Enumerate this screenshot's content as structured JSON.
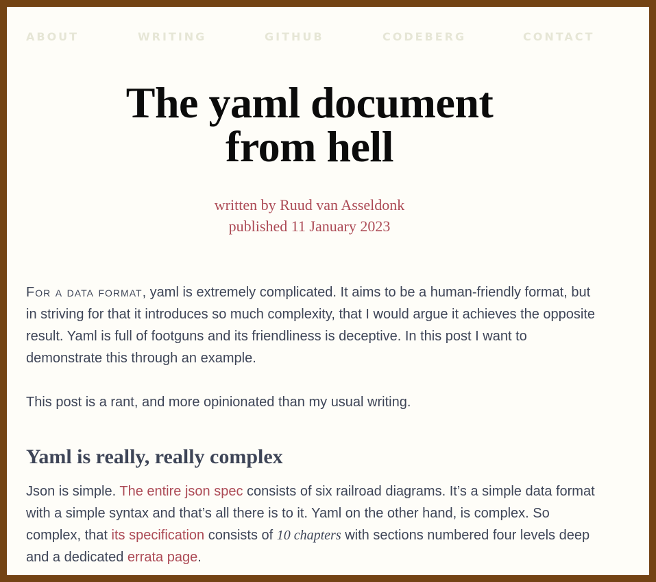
{
  "nav": {
    "about": "ABOUT",
    "writing": "WRITING",
    "github": "GITHUB",
    "codeberg": "CODEBERG",
    "contact": "CONTACT"
  },
  "article": {
    "title_line1": "The yaml document",
    "title_line2": "from hell",
    "author": "written by Ruud van Asseldonk",
    "published": "published 11 January 2023"
  },
  "content": {
    "p1_lead": "For a data format",
    "p1_rest": ", yaml is extremely complicated. It aims to be a human-friendly format, but in striving for that it introduces so much complexity, that I would argue it achieves the opposite result. Yaml is full of footguns and its friendliness is deceptive. In this post I want to demonstrate this through an example.",
    "p2": "This post is a rant, and more opinionated than my usual writing.",
    "h2": "Yaml is really, really complex",
    "p3_a": "Json is simple. ",
    "p3_link1": "The entire json spec",
    "p3_b": " consists of six railroad diagrams. It’s a simple data format with a simple syntax and that’s all there is to it. Yaml on the other hand, is complex. So complex, that ",
    "p3_link2": "its specification",
    "p3_c": " consists of ",
    "p3_em": "10 chapters",
    "p3_d": " with sections numbered four levels deep and a dedicated ",
    "p3_link3": "errata page",
    "p3_e": "."
  },
  "colors": {
    "frame": "#734314",
    "page": "#fefdf8",
    "accent": "#ac4a55",
    "text": "#3e4557",
    "nav": "#e6e6d6"
  }
}
